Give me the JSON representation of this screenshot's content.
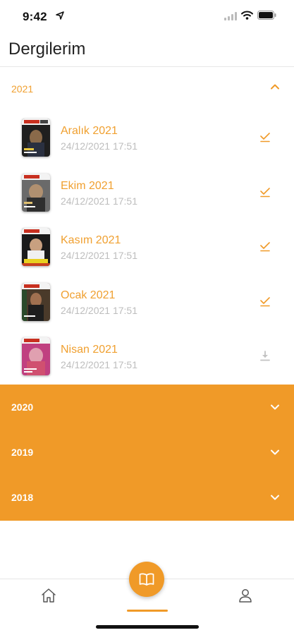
{
  "status_bar": {
    "time": "9:42"
  },
  "page": {
    "title": "Dergilerim"
  },
  "years": {
    "open": {
      "label": "2021",
      "magazines": [
        {
          "title": "Aralık 2021",
          "date": "24/12/2021 17:51",
          "status": "downloaded",
          "cover_colors": [
            "#2b2b2b",
            "#8a6a4a",
            "#c8a060"
          ]
        },
        {
          "title": "Ekim 2021",
          "date": "24/12/2021 17:51",
          "status": "downloaded",
          "cover_colors": [
            "#3a3a3a",
            "#9a9a9a",
            "#e0c070"
          ]
        },
        {
          "title": "Kasım 2021",
          "date": "24/12/2021 17:51",
          "status": "downloaded",
          "cover_colors": [
            "#1e1e1e",
            "#c84020",
            "#e8d020"
          ]
        },
        {
          "title": "Ocak 2021",
          "date": "24/12/2021 17:51",
          "status": "downloaded",
          "cover_colors": [
            "#5a3a2a",
            "#8a5a3a",
            "#2a4a2a"
          ]
        },
        {
          "title": "Nisan 2021",
          "date": "24/12/2021 17:51",
          "status": "not-downloaded",
          "cover_colors": [
            "#c04080",
            "#e0a0b0",
            "#d05070"
          ]
        }
      ]
    },
    "collapsed": [
      {
        "label": "2020"
      },
      {
        "label": "2019"
      },
      {
        "label": "2018"
      }
    ]
  },
  "colors": {
    "accent": "#f09a28",
    "muted": "#bdbdbd"
  },
  "icons": {
    "downloaded": "check-download-icon",
    "not_downloaded": "download-icon"
  },
  "tabbar": {
    "items": [
      "home-icon",
      "magazine-icon",
      "profile-icon"
    ],
    "active": "magazine-icon"
  }
}
